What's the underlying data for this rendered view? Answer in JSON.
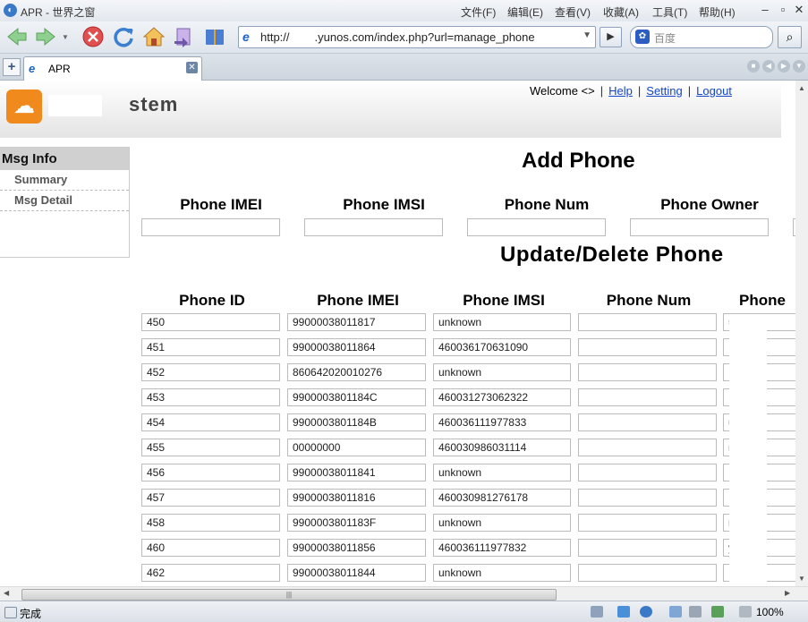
{
  "window": {
    "title": "APR - 世界之窗"
  },
  "menu": [
    "文件(F)",
    "编辑(E)",
    "查看(V)",
    "收藏(A)",
    "工具(T)",
    "帮助(H)"
  ],
  "address": {
    "scheme": "http://",
    "url": ".yunos.com/index.php?url=manage_phone"
  },
  "search": {
    "placeholder": "百度"
  },
  "tab": {
    "label": "APR"
  },
  "status": {
    "text": "完成",
    "zoom": "100%"
  },
  "header": {
    "welcome": "Welcome <>",
    "links": {
      "help": "Help",
      "setting": "Setting",
      "logout": "Logout"
    },
    "logo_text": "stem"
  },
  "sidebar": {
    "title": "Msg Info",
    "items": [
      "Summary",
      "Msg Detail"
    ]
  },
  "add_phone": {
    "heading": "Add Phone",
    "columns": [
      "Phone IMEI",
      "Phone IMSI",
      "Phone Num",
      "Phone Owner"
    ]
  },
  "update_phone": {
    "heading": "Update/Delete Phone",
    "columns": [
      "Phone ID",
      "Phone IMEI",
      "Phone IMSI",
      "Phone Num",
      "Phone"
    ],
    "rows": [
      {
        "id": "450",
        "imei": "99000038011817",
        "imsi": "unknown",
        "num": "",
        "owner": "智"
      },
      {
        "id": "451",
        "imei": "99000038011864",
        "imsi": "460036170631090",
        "num": "",
        "owner": ""
      },
      {
        "id": "452",
        "imei": "860642020010276",
        "imsi": "unknown",
        "num": "",
        "owner": ""
      },
      {
        "id": "453",
        "imei": "9900003801184C",
        "imsi": "460031273062322",
        "num": "",
        "owner": ""
      },
      {
        "id": "454",
        "imei": "9900003801184B",
        "imsi": "460036111977833",
        "num": "",
        "owner": "ua@c"
      },
      {
        "id": "455",
        "imei": "00000000",
        "imsi": "460030986031114",
        "num": "",
        "owner": "ng"
      },
      {
        "id": "456",
        "imei": "99000038011841",
        "imsi": "unknown",
        "num": "",
        "owner": ""
      },
      {
        "id": "457",
        "imei": "99000038011816",
        "imsi": "460030981276178",
        "num": "",
        "owner": ""
      },
      {
        "id": "458",
        "imei": "9900003801183F",
        "imsi": "unknown",
        "num": "",
        "owner": "n"
      },
      {
        "id": "460",
        "imei": "99000038011856",
        "imsi": "460036111977832",
        "num": "",
        "owner": "yu"
      },
      {
        "id": "462",
        "imei": "99000038011844",
        "imsi": "unknown",
        "num": "",
        "owner": ""
      }
    ]
  }
}
